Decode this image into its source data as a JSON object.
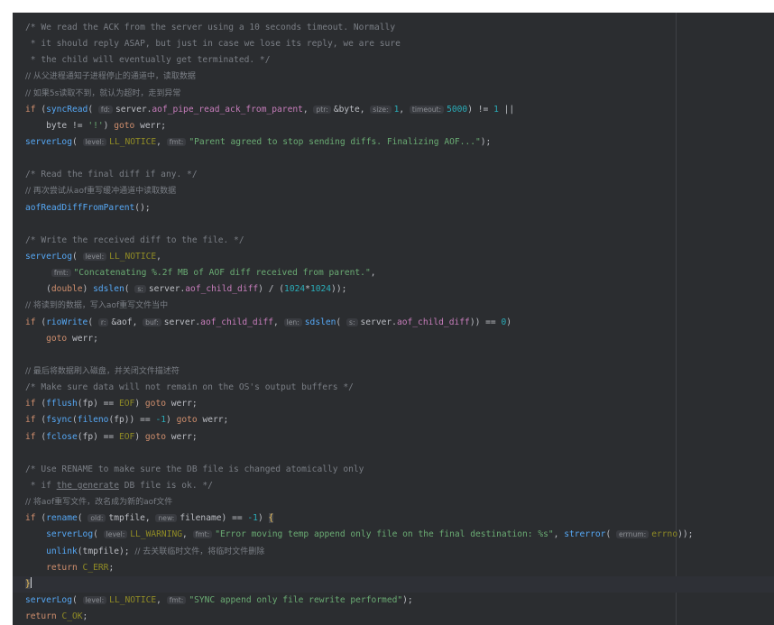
{
  "code": {
    "l1": "/* We read the ACK from the server using a 10 seconds timeout. Normally",
    "l2": " * it should reply ASAP, but just in case we lose its reply, we are sure",
    "l3": " * the child will eventually get terminated. */",
    "l4": "// 从父进程通知子进程停止的通道中，读取数据",
    "l5": "// 如果5s读取不到，就认为超时，走到异常",
    "l6": {
      "kw_if": "if",
      "open": " (",
      "fn": "syncRead",
      "paren": "( ",
      "hint_fd": "fd:",
      "arg_server": "server",
      "dot": ".",
      "field": "aof_pipe_read_ack_from_parent",
      "comma1": ", ",
      "hint_ptr": "ptr:",
      "amp": "&byte, ",
      "hint_size": "size:",
      "num1": "1",
      "comma2": ", ",
      "hint_timeout": "timeout:",
      "num2": "5000",
      "tail": ") != ",
      "num3": "1",
      "or": " ||"
    },
    "l7": {
      "indent": "    byte != ",
      "char": "'!'",
      "close": ") ",
      "kw_goto": "goto",
      "label": " werr;"
    },
    "l8": {
      "fn": "serverLog",
      "paren": "( ",
      "hint_level": "level:",
      "macro": "LL_NOTICE",
      "comma": ", ",
      "hint_fmt": "fmt:",
      "str": "\"Parent agreed to stop sending diffs. Finalizing AOF...\"",
      "tail": ");"
    },
    "l10": "/* Read the final diff if any. */",
    "l11": "// 再次尝试从aof重写缓冲通道中读取数据",
    "l12": {
      "fn": "aofReadDiffFromParent",
      "tail": "();"
    },
    "l14": "/* Write the received diff to the file. */",
    "l15": {
      "fn": "serverLog",
      "paren": "( ",
      "hint_level": "level:",
      "macro": "LL_NOTICE",
      "tail": ","
    },
    "l16": {
      "indent": "     ",
      "hint_fmt": "fmt:",
      "str": "\"Concatenating %.2f MB of AOF diff received from parent.\"",
      "tail": ","
    },
    "l17": {
      "indent": "    (",
      "kw_double": "double",
      "close": ") ",
      "fn": "sdslen",
      "paren": "( ",
      "hint_s": "s:",
      "server": "server",
      "dot": ".",
      "field": "aof_child_diff",
      "mid": ") / (",
      "num1": "1024",
      "star": "*",
      "num2": "1024",
      "tail": "));"
    },
    "l18": "// 将读到的数据，写入aof重写文件当中",
    "l19": {
      "kw_if": "if",
      "open": " (",
      "fn": "rioWrite",
      "paren": "( ",
      "hint_r": "r:",
      "arg1": "&aof, ",
      "hint_buf": "buf:",
      "server": "server",
      "dot": ".",
      "field": "aof_child_diff",
      "comma": ", ",
      "hint_len": "len:",
      "fn2": "sdslen",
      "paren2": "( ",
      "hint_s": "s:",
      "server2": "server",
      "dot2": ".",
      "field2": "aof_child_diff",
      "mid": ")) == ",
      "num": "0",
      "tail": ")"
    },
    "l20": {
      "indent": "    ",
      "kw_goto": "goto",
      "label": " werr;"
    },
    "l22": "// 最后将数据刷入磁盘，并关闭文件描述符",
    "l23": "/* Make sure data will not remain on the OS's output buffers */",
    "l24": {
      "kw_if": "if",
      "open": " (",
      "fn": "fflush",
      "args": "(fp) == ",
      "macro": "EOF",
      "close": ") ",
      "kw_goto": "goto",
      "label": " werr;"
    },
    "l25": {
      "kw_if": "if",
      "open": " (",
      "fn": "fsync",
      "paren": "(",
      "fn2": "fileno",
      "args": "(fp)) == ",
      "num": "-1",
      "close": ") ",
      "kw_goto": "goto",
      "label": " werr;"
    },
    "l26": {
      "kw_if": "if",
      "open": " (",
      "fn": "fclose",
      "args": "(fp) == ",
      "macro": "EOF",
      "close": ") ",
      "kw_goto": "goto",
      "label": " werr;"
    },
    "l28": "/* Use RENAME to make sure the DB file is changed atomically only",
    "l29": {
      "prefix": " * if ",
      "underlined": "the generate",
      "suffix": " DB file is ok. */"
    },
    "l30": "// 将aof重写文件，改名成为新的aof文件",
    "l31": {
      "kw_if": "if",
      "open": " (",
      "fn": "rename",
      "paren": "( ",
      "hint_old": "old:",
      "arg1": "tmpfile, ",
      "hint_new": "new:",
      "arg2": "filename) == ",
      "num": "-1",
      "close": ") ",
      "brace": "{"
    },
    "l32": {
      "indent": "    ",
      "fn": "serverLog",
      "paren": "( ",
      "hint_level": "level:",
      "macro": "LL_WARNING",
      "comma": ", ",
      "hint_fmt": "fmt:",
      "str": "\"Error moving temp append only file on the final destination: %s\"",
      "comma2": ", ",
      "fn2": "strerror",
      "paren2": "( ",
      "hint_errnum": "errnum:",
      "macro2": "errno",
      "tail": "));"
    },
    "l33": {
      "indent": "    ",
      "fn": "unlink",
      "args": "(tmpfile); ",
      "comment": "// 去关联临时文件，将临时文件删除"
    },
    "l34": {
      "indent": "    ",
      "kw_return": "return",
      "space": " ",
      "macro": "C_ERR",
      "tail": ";"
    },
    "l35": {
      "brace": "}"
    },
    "l36": {
      "fn": "serverLog",
      "paren": "( ",
      "hint_level": "level:",
      "macro": "LL_NOTICE",
      "comma": ", ",
      "hint_fmt": "fmt:",
      "str": "\"SYNC append only file rewrite performed\"",
      "tail": ");"
    },
    "l37": {
      "kw_return": "return",
      "space": " ",
      "macro": "C_OK",
      "tail": ";"
    }
  },
  "colors": {
    "background": "#2b2d30",
    "keyword": "#cf8e6d",
    "function": "#56a8f5",
    "field": "#c77dbb",
    "string": "#6aab73",
    "number": "#2aacb8",
    "macro": "#908b25",
    "comment": "#7a7e85"
  }
}
